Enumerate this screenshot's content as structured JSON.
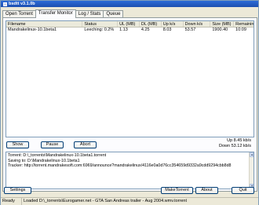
{
  "window": {
    "title": "bsdtt v3.1.0b"
  },
  "tabs": [
    {
      "label": "Open Torrent",
      "active": false
    },
    {
      "label": "Transfer Monitor",
      "active": true
    },
    {
      "label": "Log / Stats",
      "active": false
    },
    {
      "label": "Queue",
      "active": false
    }
  ],
  "transfers": {
    "columns": [
      "Filename",
      "Status",
      "UL (MB)",
      "DL (MB)",
      "Up k/s",
      "Down k/s",
      "Size (MB)",
      "Remaining"
    ],
    "rows": [
      {
        "filename": "Mandrakelinux-10.1beta1",
        "status": "Leeching: 0.2%",
        "ul_mb": "1.13",
        "dl_mb": "4.25",
        "up_ks": "8.03",
        "down_ks": "53.57",
        "size_mb": "1900.40",
        "remaining": "10:09"
      }
    ]
  },
  "speed": {
    "up": "Up 8.45 kb/s",
    "down": "Down 53.12 kb/s"
  },
  "buttons": {
    "show": "Show",
    "pause": "Pause",
    "abort": "Abort",
    "settings": "Settings",
    "make_torrent": "MakeTorrent",
    "about": "About",
    "quit": "Quit"
  },
  "info": {
    "torrent": "Torrent: D:\\_torrents\\Mandrakelinux-10.1beta1.torrent",
    "saving": "Saving to: D:\\Mandrakelinux-10.1beta1",
    "tracker": "Tracker: http://torrent.mandrakesoft.com:6969/announce?mandrakelinux/4116e0a0d76cc354659d9332a9cdd9294cbb8d8"
  },
  "statusbar": {
    "state": "Ready",
    "message": "Loaded D:\\_torrents\\Eurogamer.net - GTA San Andreas trailer - Aug 2004.wmv.torrent"
  }
}
